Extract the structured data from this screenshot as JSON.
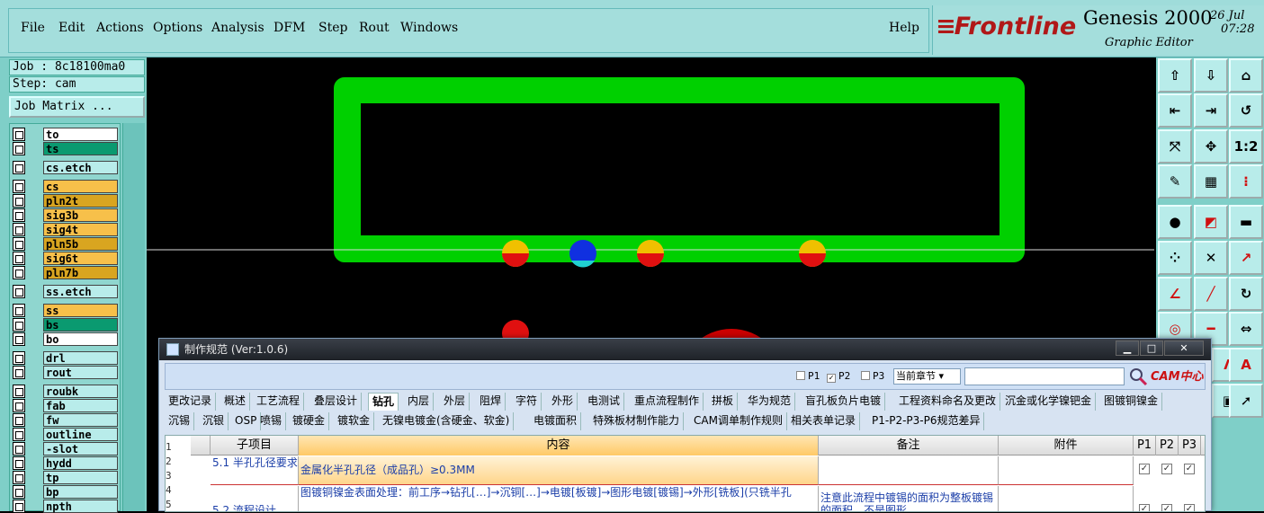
{
  "menu": {
    "items": [
      "File",
      "Edit",
      "Actions",
      "Options",
      "Analysis",
      "DFM",
      "Step",
      "Rout",
      "Windows"
    ],
    "help": "Help"
  },
  "brand": {
    "logo": "Frontline",
    "app_name": "Genesis 2000",
    "subtitle": "Graphic Editor",
    "date": "26 Jul",
    "time": "07:28"
  },
  "left": {
    "job": "Job : 8c18100ma0",
    "step": "Step: cam",
    "job_matrix": "Job Matrix ...",
    "layers": [
      {
        "name": "to",
        "color": "#ffffff"
      },
      {
        "name": "ts",
        "color": "#0a9a70"
      },
      {
        "name": "cs.etch",
        "color": "#b8ecea"
      },
      {
        "name": "cs",
        "color": "#f7c04a"
      },
      {
        "name": "pln2t",
        "color": "#d9a520"
      },
      {
        "name": "sig3b",
        "color": "#f7c04a"
      },
      {
        "name": "sig4t",
        "color": "#f7c04a"
      },
      {
        "name": "pln5b",
        "color": "#d9a520"
      },
      {
        "name": "sig6t",
        "color": "#f7c04a"
      },
      {
        "name": "pln7b",
        "color": "#d9a520"
      },
      {
        "name": "ss.etch",
        "color": "#b8ecea"
      },
      {
        "name": "ss",
        "color": "#f7c04a"
      },
      {
        "name": "bs",
        "color": "#0a9a70"
      },
      {
        "name": "bo",
        "color": "#ffffff"
      },
      {
        "name": "drl",
        "color": "#b8ecea"
      },
      {
        "name": "rout",
        "color": "#b8ecea"
      },
      {
        "name": "roubk",
        "color": "#b8ecea"
      },
      {
        "name": "fab",
        "color": "#b8ecea"
      },
      {
        "name": "fw",
        "color": "#b8ecea"
      },
      {
        "name": "outline",
        "color": "#b8ecea"
      },
      {
        "name": "-slot",
        "color": "#b8ecea"
      },
      {
        "name": "hydd",
        "color": "#b8ecea"
      },
      {
        "name": "tp",
        "color": "#b8ecea"
      },
      {
        "name": "bp",
        "color": "#b8ecea"
      },
      {
        "name": "npth",
        "color": "#b8ecea"
      }
    ]
  },
  "dialog": {
    "title": "制作规范 (Ver:1.0.6)",
    "options": {
      "p1": "P1",
      "p2": "P2",
      "p3": "P3",
      "chapter": "当前章节"
    },
    "cam_logo": "CAM",
    "cam_logo_cn": "中心",
    "tabs_row1": [
      "更改记录",
      "概述",
      "工艺流程",
      "叠层设计",
      "钻孔",
      "内层",
      "外层",
      "阻焊",
      "字符",
      "外形",
      "电测试",
      "重点流程制作",
      "拼板",
      "华为规范",
      "盲孔板负片电镀",
      "工程资料命名及更改",
      "沉金或化学镍钯金",
      "图镀铜镍金"
    ],
    "tabs_row2": [
      "沉锡",
      "沉银",
      "OSP",
      "喷锡",
      "镀硬金",
      "镀软金",
      "无镍电镀金(含硬金、软金)",
      "电镀面积",
      "特殊板材制作能力",
      "CAM调单制作规则",
      "相关表单记录",
      "P1-P2-P3-P6规范差异"
    ],
    "active_tab": "钻孔",
    "table": {
      "headers": [
        "子项目",
        "内容",
        "备注",
        "附件",
        "P1",
        "P2",
        "P3"
      ],
      "row_numbers": [
        "1",
        "2",
        "3",
        "4",
        "5"
      ],
      "rows": [
        {
          "sub": "5.1 半孔孔径要求",
          "content": "金属化半孔孔径（成品孔）≥0.3MM",
          "note": ""
        },
        {
          "sub": "5.2 流程设计",
          "content": "图镀铜镍金表面处理：前工序→钻孔[…]→沉铜[…]→电镀[板镀]→图形电镀[镀锡]→外形[铣板](只铣半孔",
          "note": "注意此流程中镀锡的面积为整板镀锡的面积，不是图形"
        }
      ]
    }
  }
}
